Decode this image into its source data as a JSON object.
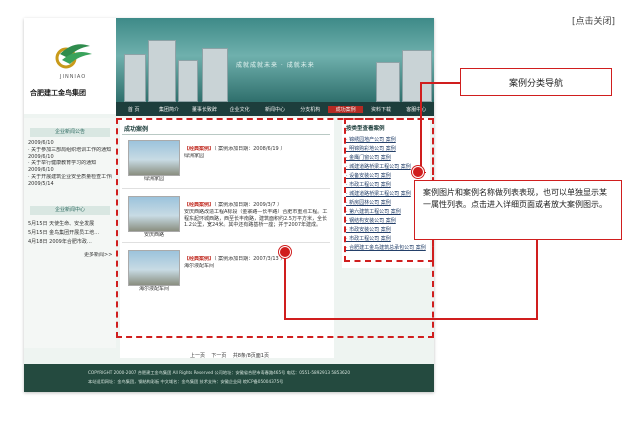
{
  "close_link": "[点击关闭]",
  "site": {
    "logo_en": "JINNIAO",
    "logo_cn": "合肥建工金鸟集团",
    "banner_slogan": "成就成就未来 · 成就未来",
    "nav": [
      "首 页",
      "集团简介",
      "董事长致辞",
      "企业文化",
      "新闻中心",
      "分支机构",
      "成功案例",
      "资料下载",
      "客服中心"
    ],
    "nav_active_index": 6,
    "left": {
      "section1_title": "企业新闻公告",
      "news": [
        {
          "date": "2009/6/10",
          "text": "· 关于参加三部局组织培训工作的通知"
        },
        {
          "date": "2009/6/10",
          "text": "· 关于举行健康教育学习的通知"
        },
        {
          "date": "2009/6/10",
          "text": "· 关于开展建筑企业安全质量检查工作的通知"
        },
        {
          "date": "2009/5/14",
          "text": ""
        }
      ],
      "section2_title": "企业新闻中心",
      "items": [
        "5月15日 天使生命、安全发展",
        "5月15日 金鸟集团开展员工培…",
        "4月18日 2009年合肥市政…"
      ],
      "more": "更多新闻>>"
    },
    "main": {
      "title": "成功案例",
      "cases": [
        {
          "tag": "【经典案例】",
          "added": "（ 案例添加日期：2008/6/19 ）",
          "name": "绿洲家园",
          "desc": "",
          "thumb_caption": "绿洲家园"
        },
        {
          "tag": "【经典案例】",
          "added": "（ 案例添加日期：2009/3/7 ）",
          "name": "安庆西路",
          "desc": "安庆西路改造工程A标段（金寨路—长丰路）合肥市重点工程。工程东起环城西路，西至长丰南路，建筑面积约2.5万平方米，全长1.2公里，宽24米。其中还有路基桥一座；并于2007年建成。",
          "thumb_caption": "安庆西路"
        },
        {
          "tag": "【经典案例】",
          "added": "（ 案例添加日期：2007/3/13 ）",
          "name": "海尔液配车间",
          "desc": "",
          "thumb_caption": "海尔液配车间"
        }
      ]
    },
    "right": {
      "title": "按类型查看案例",
      "items": [
        "· 锦绣园地产公司  案例",
        "· 明锦购彩地公司  案例",
        "· 金鹰门窗公司  案例",
        "· 城建道路桥梁工程公司 案例",
        "· 设备安装公司 案例",
        "· 市政工程公司 案例",
        "· 城建道路桥梁工程公司 案例",
        "· 新房园林公司 案例",
        "· 第六建筑工程公司 案例",
        "· 钢结构安装公司 案例",
        "· 市政安装公司 案例",
        "· 市政工程公司 案例",
        "· 合肥建工金鸟建筑总承包公司 案例"
      ]
    },
    "pager": [
      "上一页",
      "下一页",
      "共8条/8页面1页"
    ],
    "footer": {
      "line1": "COPYRIGHT 2000-2007 合肥建工金鸟集团 All Rights Reserved  公司地址：安徽省合肥市寿春路465号  电话：0551-5892913 5853620",
      "line2": "本站适用网址：金鸟集团，钢结构彩板    中文域名：金鸟集团    技术支持：安徽企业网 皖ICP备05004375号"
    }
  },
  "annotations": {
    "box1": "案例分类导航",
    "box2": "案例图片和案例名称做列表表现，也可以单独显示某一属性列表。点击进入详细页面或者放大案例图示。"
  },
  "colors": {
    "accent_red": "#d01e1e",
    "nav_dark": "#1d3e3c",
    "footer": "#244a3f"
  }
}
